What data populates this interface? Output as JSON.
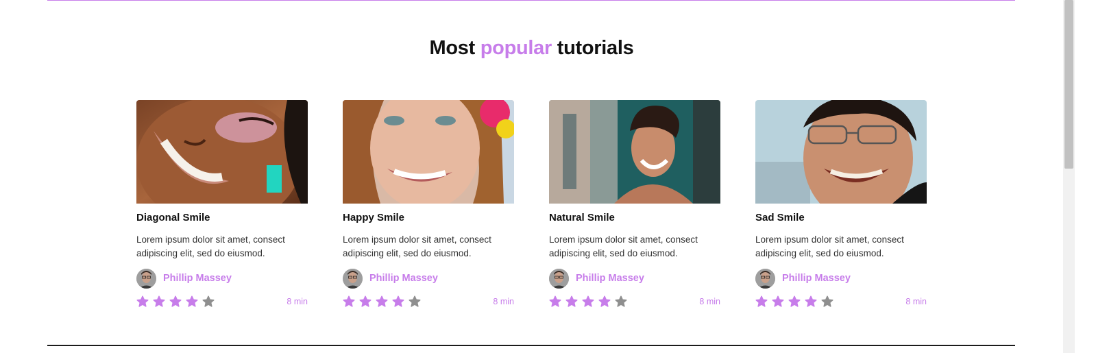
{
  "section": {
    "title_prefix": "Most ",
    "title_accent": "popular",
    "title_suffix": " tutorials"
  },
  "colors": {
    "accent": "#c77dea",
    "star_filled": "#c77dea",
    "star_empty": "#8f8f8f"
  },
  "cards": [
    {
      "title": "Diagonal Smile",
      "description": "Lorem ipsum dolor sit amet, consect adipiscing elit, sed do eiusmod.",
      "author": "Phillip Massey",
      "rating": 4,
      "rating_max": 5,
      "duration": "8 min",
      "image_icon": "smiling-woman-photo"
    },
    {
      "title": "Happy Smile",
      "description": "Lorem ipsum dolor sit amet, consect adipiscing elit, sed do eiusmod.",
      "author": "Phillip Massey",
      "rating": 4,
      "rating_max": 5,
      "duration": "8 min",
      "image_icon": "smiling-girl-photo"
    },
    {
      "title": "Natural Smile",
      "description": "Lorem ipsum dolor sit amet, consect adipiscing elit, sed do eiusmod.",
      "author": "Phillip Massey",
      "rating": 4,
      "rating_max": 5,
      "duration": "8 min",
      "image_icon": "smiling-man-photo"
    },
    {
      "title": "Sad Smile",
      "description": "Lorem ipsum dolor sit amet, consect adipiscing elit, sed do eiusmod.",
      "author": "Phillip Massey",
      "rating": 4,
      "rating_max": 5,
      "duration": "8 min",
      "image_icon": "smiling-man-glasses-photo"
    }
  ]
}
